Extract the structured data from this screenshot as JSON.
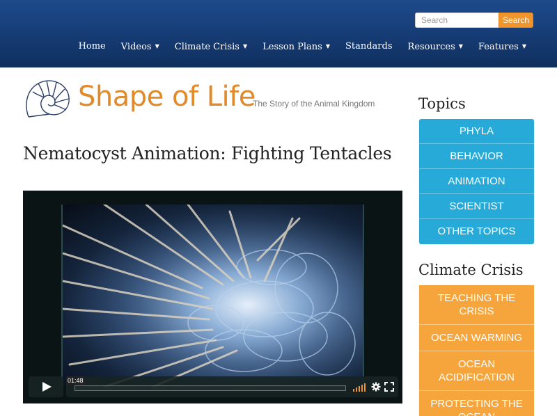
{
  "search": {
    "placeholder": "Search",
    "button_label": "Search"
  },
  "nav": [
    {
      "label": "Home",
      "has_dropdown": false
    },
    {
      "label": "Videos",
      "has_dropdown": true
    },
    {
      "label": "Climate Crisis",
      "has_dropdown": true
    },
    {
      "label": "Lesson Plans",
      "has_dropdown": true
    },
    {
      "label": "Standards",
      "has_dropdown": false
    },
    {
      "label": "Resources",
      "has_dropdown": true
    },
    {
      "label": "Features",
      "has_dropdown": true
    }
  ],
  "logo": {
    "title": "Shape of Life",
    "tagline": "The Story of the Animal Kingdom"
  },
  "page_title": "Nematocyst Animation: Fighting Tentacles",
  "video": {
    "time": "01:48"
  },
  "sidebar": {
    "topics_heading": "Topics",
    "topics": [
      "PHYLA",
      "BEHAVIOR",
      "ANIMATION",
      "SCIENTIST",
      "OTHER TOPICS"
    ],
    "climate_heading": "Climate Crisis",
    "climate": [
      "TEACHING THE CRISIS",
      "OCEAN WARMING",
      "OCEAN ACIDIFICATION",
      "PROTECTING THE OCEAN"
    ]
  },
  "colors": {
    "header": "#173e78",
    "search_button": "#f0952b",
    "topics": "#27aad8",
    "climate": "#f6a43c",
    "logo": "#e08a2b"
  }
}
